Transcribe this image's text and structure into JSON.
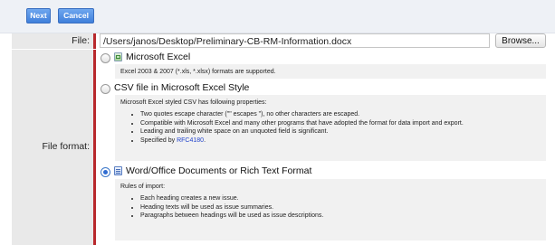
{
  "toolbar": {
    "next_label": "Next",
    "cancel_label": "Cancel"
  },
  "file": {
    "label": "File:",
    "value": "/Users/janos/Desktop/Preliminary-CB-RM-Information.docx",
    "browse_label": "Browse..."
  },
  "format": {
    "label": "File format:",
    "options": [
      {
        "title": "Microsoft Excel",
        "icon": "excel-file-icon",
        "selected": false,
        "description": "Excel 2003 & 2007 (*.xls, *.xlsx) formats are supported."
      },
      {
        "title": "CSV file in Microsoft Excel Style",
        "selected": false,
        "description": "Microsoft Excel styled CSV has following properties:",
        "bullets": [
          "Two quotes escape character (\"\" escapes \"), no other characters are escaped.",
          "Compatible with Microsoft Excel and many other programs that have adopted the format for data import and export.",
          "Leading and trailing white space on an unquoted field is significant."
        ],
        "specified_prefix": "Specified by ",
        "specified_link": "RFC4180",
        "specified_suffix": "."
      },
      {
        "title": "Word/Office Documents or Rich Text Format",
        "icon": "word-document-icon",
        "selected": true,
        "description": "Rules of import:",
        "bullets": [
          "Each heading creates a new issue.",
          "Heading texts will be used as issue summaries.",
          "Paragraphs between headings will be used as issue descriptions."
        ]
      }
    ]
  }
}
